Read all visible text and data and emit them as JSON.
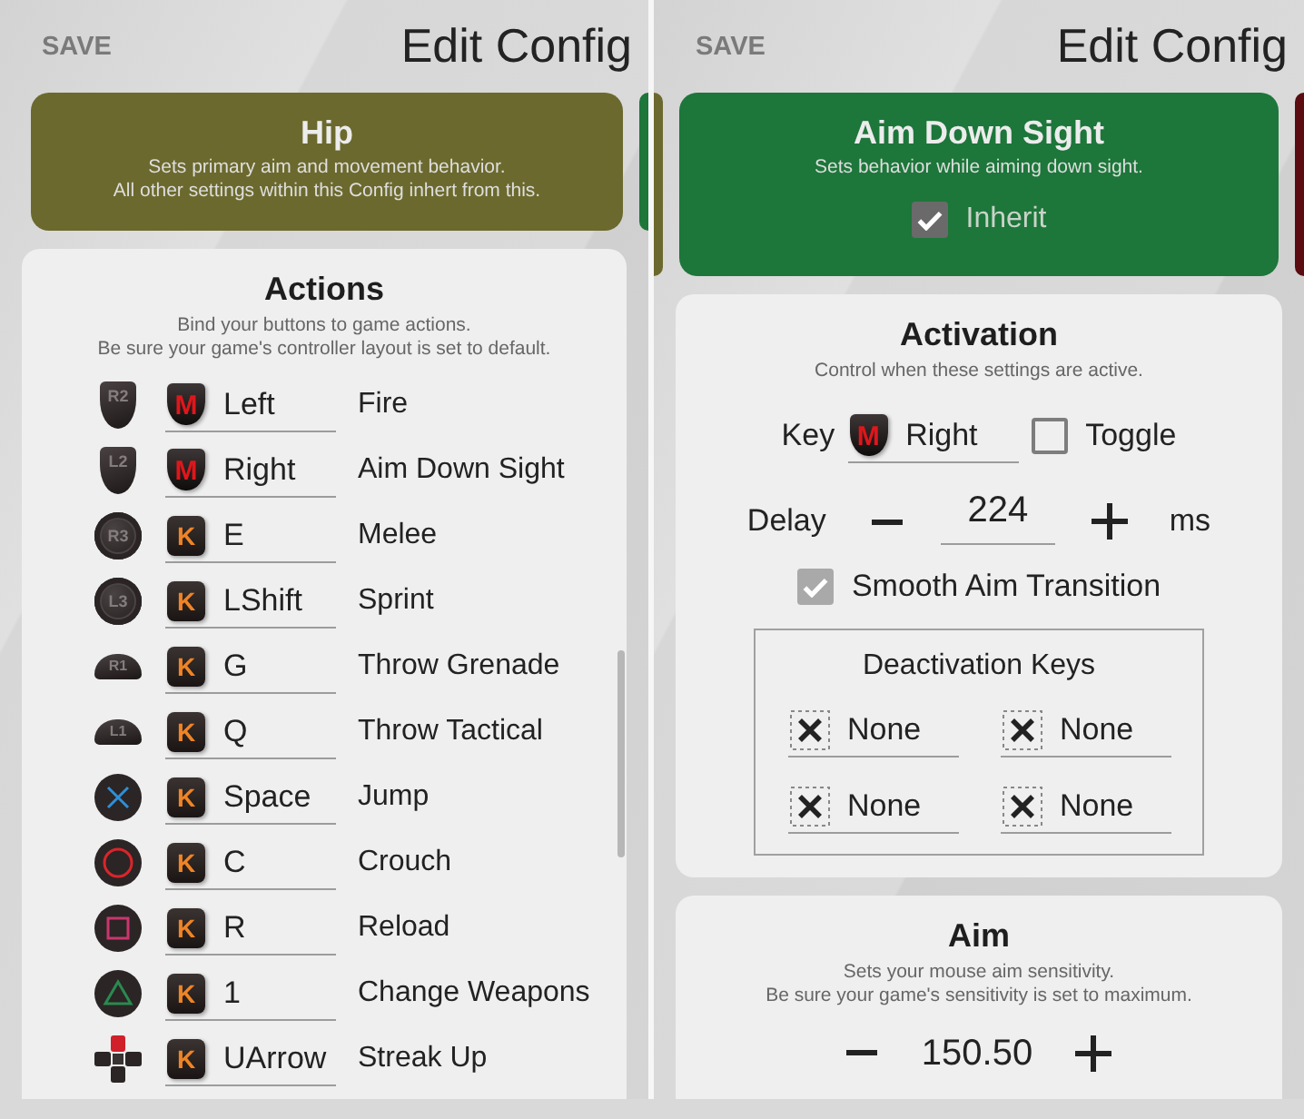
{
  "screens": [
    {
      "header": {
        "save": "SAVE",
        "title": "Edit Config"
      },
      "mode_card": {
        "title": "Hip",
        "color": "#6b692d",
        "description": [
          "Sets primary aim and movement behavior.",
          "All other settings within this Config inhert from this."
        ]
      },
      "sections": [
        {
          "kind": "actions",
          "title": "Actions",
          "description": [
            "Bind your buttons to game actions.",
            "Be sure your game's controller layout is set to default."
          ],
          "rows": [
            {
              "button": {
                "kind": "trigger",
                "label": "R2"
              },
              "input": {
                "kind": "mouse",
                "badge": "M",
                "key": "Left"
              },
              "action": "Fire"
            },
            {
              "button": {
                "kind": "trigger",
                "label": "L2"
              },
              "input": {
                "kind": "mouse",
                "badge": "M",
                "key": "Right"
              },
              "action": "Aim Down Sight"
            },
            {
              "button": {
                "kind": "stick",
                "label": "R3"
              },
              "input": {
                "kind": "keyboard",
                "badge": "K",
                "key": "E"
              },
              "action": "Melee"
            },
            {
              "button": {
                "kind": "stick",
                "label": "L3"
              },
              "input": {
                "kind": "keyboard",
                "badge": "K",
                "key": "LShift"
              },
              "action": "Sprint"
            },
            {
              "button": {
                "kind": "bumper",
                "label": "R1"
              },
              "input": {
                "kind": "keyboard",
                "badge": "K",
                "key": "G"
              },
              "action": "Throw Grenade"
            },
            {
              "button": {
                "kind": "bumper",
                "label": "L1"
              },
              "input": {
                "kind": "keyboard",
                "badge": "K",
                "key": "Q"
              },
              "action": "Throw Tactical"
            },
            {
              "button": {
                "kind": "cross"
              },
              "input": {
                "kind": "keyboard",
                "badge": "K",
                "key": "Space"
              },
              "action": "Jump"
            },
            {
              "button": {
                "kind": "circle"
              },
              "input": {
                "kind": "keyboard",
                "badge": "K",
                "key": "C"
              },
              "action": "Crouch"
            },
            {
              "button": {
                "kind": "square"
              },
              "input": {
                "kind": "keyboard",
                "badge": "K",
                "key": "R"
              },
              "action": "Reload"
            },
            {
              "button": {
                "kind": "triangle"
              },
              "input": {
                "kind": "keyboard",
                "badge": "K",
                "key": "1"
              },
              "action": "Change Weapons"
            },
            {
              "button": {
                "kind": "dpad_up"
              },
              "input": {
                "kind": "keyboard",
                "badge": "K",
                "key": "UArrow"
              },
              "action": "Streak Up"
            }
          ]
        }
      ]
    },
    {
      "header": {
        "save": "SAVE",
        "title": "Edit Config"
      },
      "mode_card": {
        "title": "Aim Down Sight",
        "color": "#1d763a",
        "description": [
          "Sets behavior while aiming down sight."
        ],
        "inherit": {
          "label": "Inherit",
          "checked": true
        }
      },
      "sections": [
        {
          "kind": "activation",
          "title": "Activation",
          "description": [
            "Control when these settings are active."
          ],
          "key": {
            "label": "Key",
            "input": {
              "kind": "mouse",
              "badge": "M",
              "key": "Right"
            }
          },
          "toggle": {
            "label": "Toggle",
            "checked": false
          },
          "delay": {
            "label": "Delay",
            "value": "224",
            "unit": "ms"
          },
          "smooth_aim_transition": {
            "label": "Smooth Aim Transition",
            "checked": true
          },
          "deactivation_keys": {
            "title": "Deactivation Keys",
            "keys": [
              {
                "kind": "none",
                "key": "None"
              },
              {
                "kind": "none",
                "key": "None"
              },
              {
                "kind": "none",
                "key": "None"
              },
              {
                "kind": "none",
                "key": "None"
              }
            ]
          }
        },
        {
          "kind": "aim",
          "title": "Aim",
          "description": [
            "Sets your mouse aim sensitivity.",
            "Be sure your game's sensitivity is set to maximum."
          ],
          "sensitivity": {
            "value": "150.50"
          }
        }
      ]
    }
  ]
}
